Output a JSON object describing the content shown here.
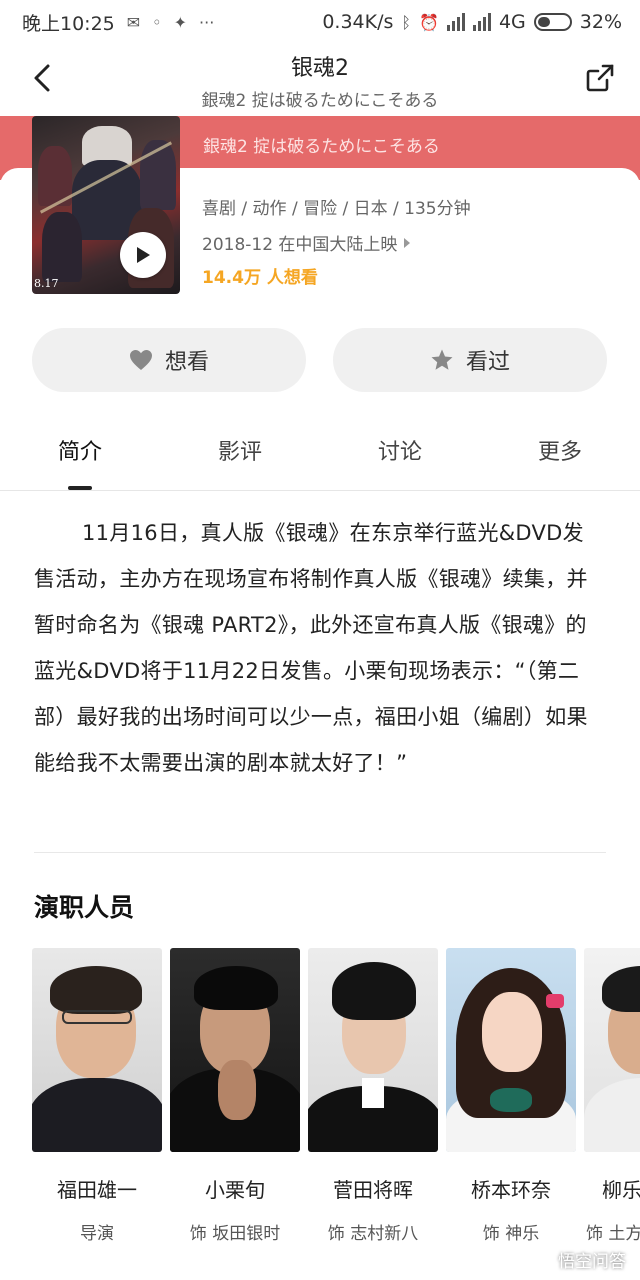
{
  "status_bar": {
    "time": "晚上10:25",
    "speed": "0.34K/s",
    "network": "4G",
    "battery": "32%"
  },
  "header": {
    "title": "银魂2",
    "subtitle": "銀魂2 掟は破るためにこそある"
  },
  "hero": {
    "band_title": "银魂2",
    "band_subtitle": "銀魂2 掟は破るためにこそある",
    "poster_date": "8.17"
  },
  "movie": {
    "genres": "喜剧 / 动作 / 冒险 / 日本 / 135分钟",
    "release": "2018-12 在中国大陆上映",
    "wish_count": "14.4万 人想看"
  },
  "actions": {
    "want_label": "想看",
    "watched_label": "看过"
  },
  "tabs": [
    "简介",
    "影评",
    "讨论",
    "更多"
  ],
  "intro": {
    "text": "11月16日，真人版《银魂》在东京举行蓝光&DVD发售活动，主办方在现场宣布将制作真人版《银魂》续集，并暂时命名为《银魂 PART2》，此外还宣布真人版《银魂》的蓝光&DVD将于11月22日发售。小栗旬现场表示：“（第二部）最好我的出场时间可以少一点，福田小姐（编剧）如果能给我不太需要出演的剧本就太好了！”"
  },
  "cast_section": {
    "title": "演职人员",
    "members": [
      {
        "name": "福田雄一",
        "role": "导演"
      },
      {
        "name": "小栗旬",
        "role": "饰 坂田银时"
      },
      {
        "name": "菅田将晖",
        "role": "饰 志村新八"
      },
      {
        "name": "桥本环奈",
        "role": "饰 神乐"
      },
      {
        "name": "柳乐",
        "role": "饰 土方"
      }
    ]
  },
  "watermark": "悟空问答",
  "colors": {
    "hero_band": "#e56a6a",
    "wish_count": "#f5a623",
    "button_bg": "#f0f0f0"
  }
}
